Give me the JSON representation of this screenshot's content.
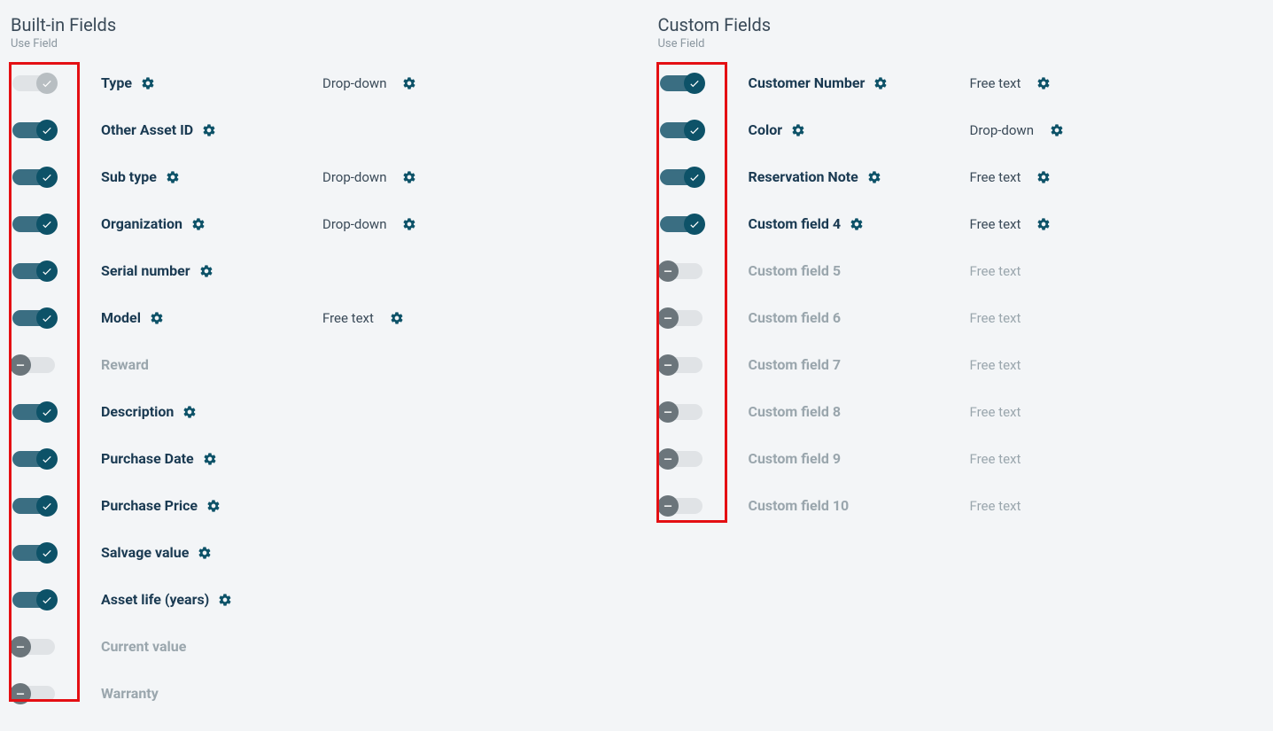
{
  "builtIn": {
    "title": "Built-in Fields",
    "sub": "Use Field",
    "rows": [
      {
        "name": "Type",
        "state": "locked",
        "hasGear": true,
        "type": "Drop-down",
        "typeGear": true
      },
      {
        "name": "Other Asset ID",
        "state": "on",
        "hasGear": true,
        "type": "",
        "typeGear": false
      },
      {
        "name": "Sub type",
        "state": "on",
        "hasGear": true,
        "type": "Drop-down",
        "typeGear": true
      },
      {
        "name": "Organization",
        "state": "on",
        "hasGear": true,
        "type": "Drop-down",
        "typeGear": true
      },
      {
        "name": "Serial number",
        "state": "on",
        "hasGear": true,
        "type": "",
        "typeGear": false
      },
      {
        "name": "Model",
        "state": "on",
        "hasGear": true,
        "type": "Free text",
        "typeGear": true
      },
      {
        "name": "Reward",
        "state": "off",
        "hasGear": false,
        "type": "",
        "typeGear": false
      },
      {
        "name": "Description",
        "state": "on",
        "hasGear": true,
        "type": "",
        "typeGear": false
      },
      {
        "name": "Purchase Date",
        "state": "on",
        "hasGear": true,
        "type": "",
        "typeGear": false
      },
      {
        "name": "Purchase Price",
        "state": "on",
        "hasGear": true,
        "type": "",
        "typeGear": false
      },
      {
        "name": "Salvage value",
        "state": "on",
        "hasGear": true,
        "type": "",
        "typeGear": false
      },
      {
        "name": "Asset life (years)",
        "state": "on",
        "hasGear": true,
        "type": "",
        "typeGear": false
      },
      {
        "name": "Current value",
        "state": "off",
        "hasGear": false,
        "type": "",
        "typeGear": false
      },
      {
        "name": "Warranty",
        "state": "off",
        "hasGear": false,
        "type": "",
        "typeGear": false
      }
    ]
  },
  "custom": {
    "title": "Custom Fields",
    "sub": "Use Field",
    "rows": [
      {
        "name": "Customer Number",
        "state": "on",
        "hasGear": true,
        "type": "Free text",
        "typeGear": true
      },
      {
        "name": "Color",
        "state": "on",
        "hasGear": true,
        "type": "Drop-down",
        "typeGear": true
      },
      {
        "name": "Reservation Note",
        "state": "on",
        "hasGear": true,
        "type": "Free text",
        "typeGear": true
      },
      {
        "name": "Custom field 4",
        "state": "on",
        "hasGear": true,
        "type": "Free text",
        "typeGear": true
      },
      {
        "name": "Custom field 5",
        "state": "off",
        "hasGear": false,
        "type": "Free text",
        "typeGear": false
      },
      {
        "name": "Custom field 6",
        "state": "off",
        "hasGear": false,
        "type": "Free text",
        "typeGear": false
      },
      {
        "name": "Custom field 7",
        "state": "off",
        "hasGear": false,
        "type": "Free text",
        "typeGear": false
      },
      {
        "name": "Custom field 8",
        "state": "off",
        "hasGear": false,
        "type": "Free text",
        "typeGear": false
      },
      {
        "name": "Custom field 9",
        "state": "off",
        "hasGear": false,
        "type": "Free text",
        "typeGear": false
      },
      {
        "name": "Custom field 10",
        "state": "off",
        "hasGear": false,
        "type": "Free text",
        "typeGear": false
      }
    ]
  }
}
